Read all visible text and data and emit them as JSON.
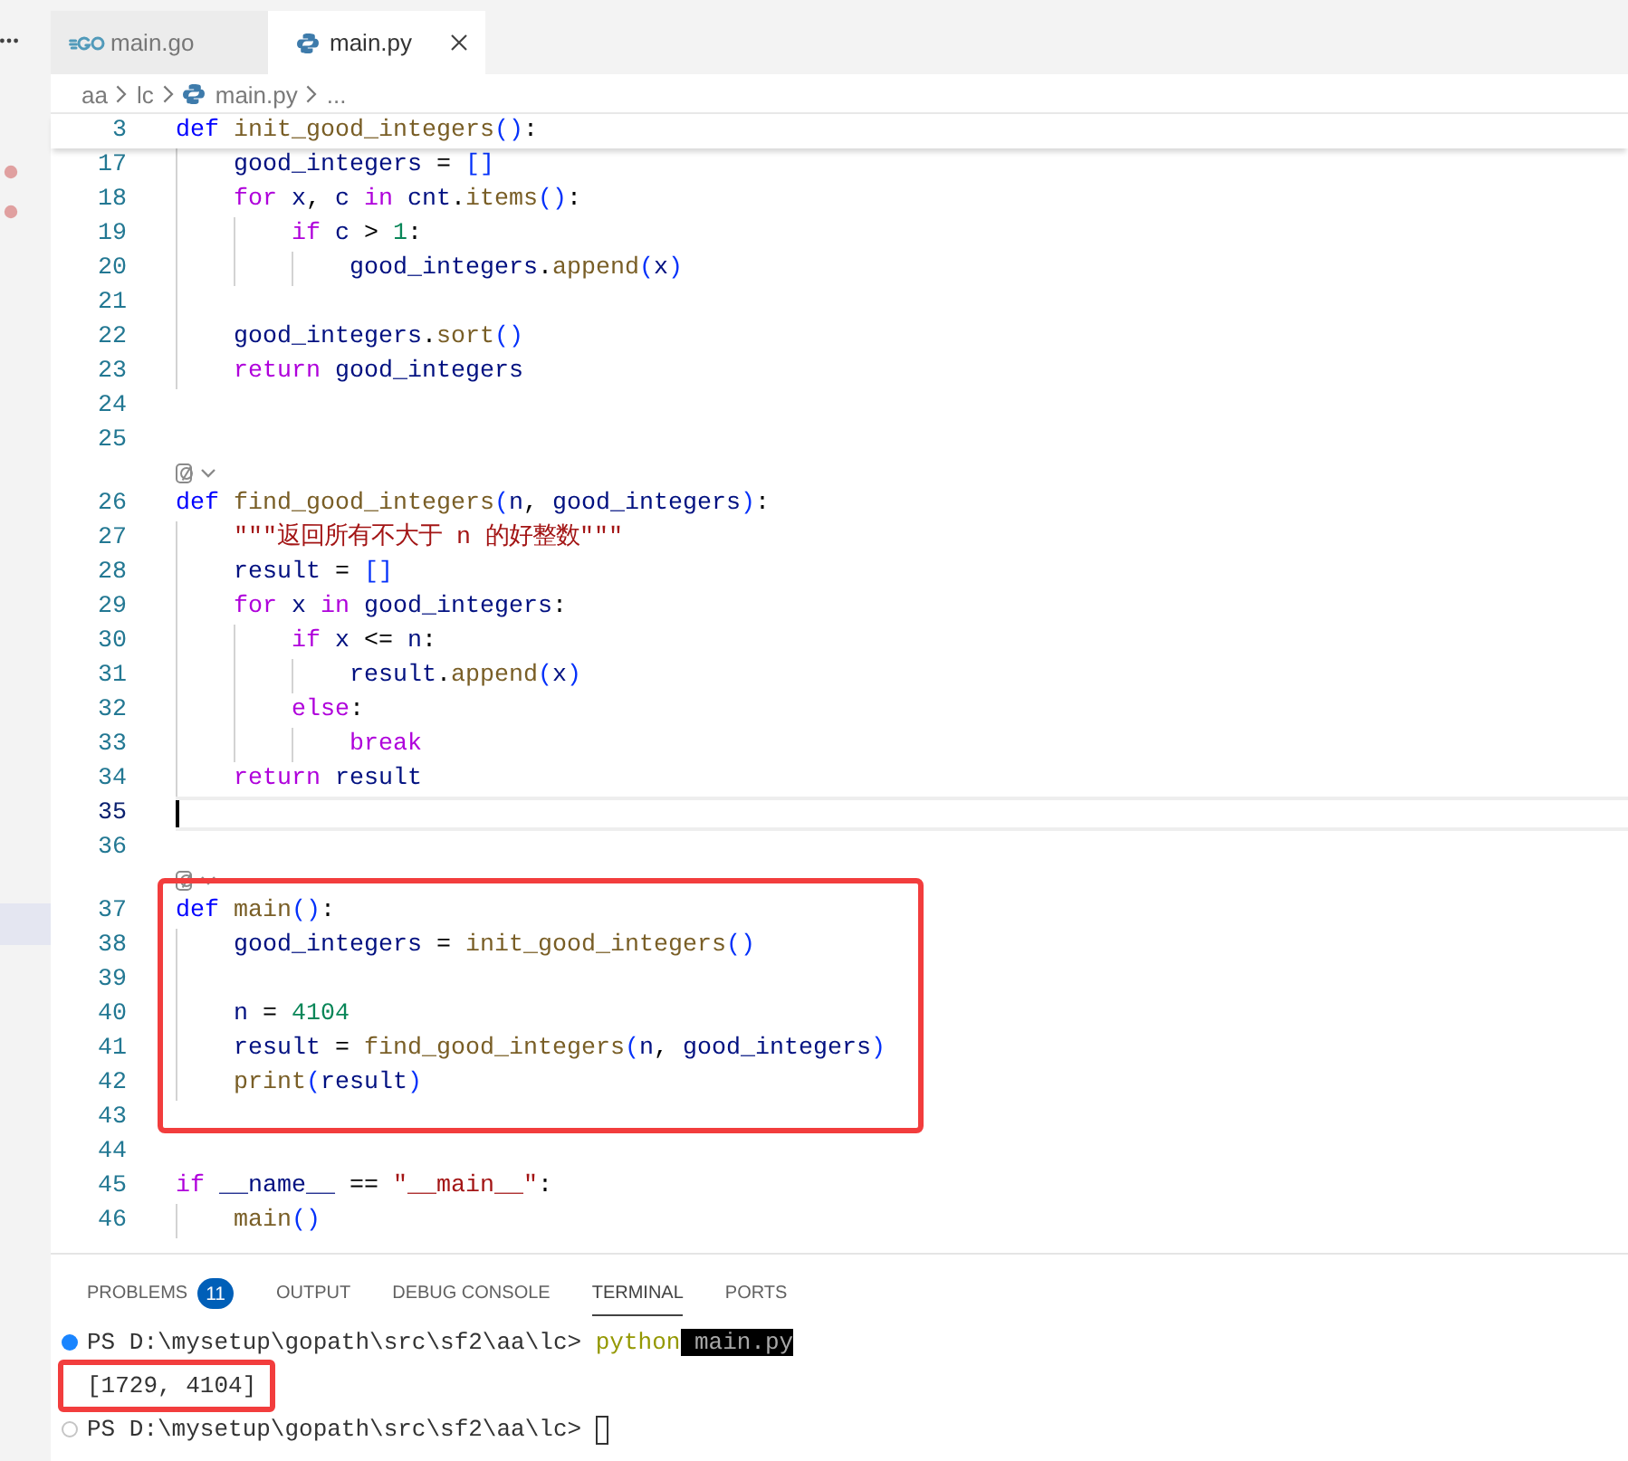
{
  "sidebar": {
    "items": [
      {
        "kind": "marked"
      },
      {
        "kind": "marked"
      },
      {
        "kind": "selected"
      }
    ]
  },
  "tabs": [
    {
      "label": "main.go",
      "kind": "go",
      "selected": false
    },
    {
      "label": "main.py",
      "kind": "python",
      "selected": true
    }
  ],
  "editor": {
    "breadcrumbs": [
      {
        "text": "aa",
        "kind": "folder"
      },
      {
        "text": "lc",
        "kind": "folder"
      },
      {
        "text": "main.py",
        "kind": "file"
      },
      {
        "text": "...",
        "kind": "symbol"
      }
    ],
    "sticky_line": {
      "number": "3",
      "tokens": [
        {
          "text": "def ",
          "kind": "keyword"
        },
        {
          "text": "init_good_integers",
          "kind": "function"
        },
        {
          "text": "()",
          "kind": "bracket"
        },
        {
          "text": ":",
          "kind": "plain"
        }
      ]
    },
    "lines": [
      {
        "kind": "code",
        "number": "17",
        "current": false,
        "tokens": [
          {
            "text": "    good_integers",
            "kind": "variable"
          },
          {
            "text": " = ",
            "kind": "plain"
          },
          {
            "text": "[]",
            "kind": "bracket"
          }
        ]
      },
      {
        "kind": "code",
        "number": "18",
        "current": false,
        "tokens": [
          {
            "text": "    for ",
            "kind": "control"
          },
          {
            "text": "x",
            "kind": "variable"
          },
          {
            "text": ", ",
            "kind": "plain"
          },
          {
            "text": "c",
            "kind": "variable"
          },
          {
            "text": " in ",
            "kind": "control"
          },
          {
            "text": "cnt",
            "kind": "variable"
          },
          {
            "text": ".",
            "kind": "plain"
          },
          {
            "text": "items",
            "kind": "function"
          },
          {
            "text": "()",
            "kind": "bracket"
          },
          {
            "text": ":",
            "kind": "plain"
          }
        ]
      },
      {
        "kind": "code",
        "number": "19",
        "current": false,
        "tokens": [
          {
            "text": "        if ",
            "kind": "control"
          },
          {
            "text": "c",
            "kind": "variable"
          },
          {
            "text": " > ",
            "kind": "plain"
          },
          {
            "text": "1",
            "kind": "number"
          },
          {
            "text": ":",
            "kind": "plain"
          }
        ]
      },
      {
        "kind": "code",
        "number": "20",
        "current": false,
        "tokens": [
          {
            "text": "            good_integers",
            "kind": "variable"
          },
          {
            "text": ".",
            "kind": "plain"
          },
          {
            "text": "append",
            "kind": "function"
          },
          {
            "text": "(",
            "kind": "bracket"
          },
          {
            "text": "x",
            "kind": "variable"
          },
          {
            "text": ")",
            "kind": "bracket"
          }
        ]
      },
      {
        "kind": "code",
        "number": "21",
        "current": false
      },
      {
        "kind": "code",
        "number": "22",
        "current": false,
        "tokens": [
          {
            "text": "    good_integers",
            "kind": "variable"
          },
          {
            "text": ".",
            "kind": "plain"
          },
          {
            "text": "sort",
            "kind": "function"
          },
          {
            "text": "()",
            "kind": "bracket"
          }
        ]
      },
      {
        "kind": "code",
        "number": "23",
        "current": false,
        "tokens": [
          {
            "text": "    return ",
            "kind": "control"
          },
          {
            "text": "good_integers",
            "kind": "variable"
          }
        ]
      },
      {
        "kind": "code",
        "number": "24",
        "current": false
      },
      {
        "kind": "code",
        "number": "25",
        "current": false
      },
      {
        "kind": "codelens"
      },
      {
        "kind": "code",
        "number": "26",
        "current": false,
        "tokens": [
          {
            "text": "def ",
            "kind": "keyword"
          },
          {
            "text": "find_good_integers",
            "kind": "function"
          },
          {
            "text": "(",
            "kind": "bracket"
          },
          {
            "text": "n",
            "kind": "variable"
          },
          {
            "text": ", ",
            "kind": "plain"
          },
          {
            "text": "good_integers",
            "kind": "variable"
          },
          {
            "text": ")",
            "kind": "bracket"
          },
          {
            "text": ":",
            "kind": "plain"
          }
        ]
      },
      {
        "kind": "code",
        "number": "27",
        "current": false,
        "tokens": [
          {
            "text": "    \"\"\"返回所有不大于 n 的好整数\"\"\"",
            "kind": "string"
          }
        ]
      },
      {
        "kind": "code",
        "number": "28",
        "current": false,
        "tokens": [
          {
            "text": "    result",
            "kind": "variable"
          },
          {
            "text": " = ",
            "kind": "plain"
          },
          {
            "text": "[]",
            "kind": "bracket"
          }
        ]
      },
      {
        "kind": "code",
        "number": "29",
        "current": false,
        "tokens": [
          {
            "text": "    for ",
            "kind": "control"
          },
          {
            "text": "x",
            "kind": "variable"
          },
          {
            "text": " in ",
            "kind": "control"
          },
          {
            "text": "good_integers",
            "kind": "variable"
          },
          {
            "text": ":",
            "kind": "plain"
          }
        ]
      },
      {
        "kind": "code",
        "number": "30",
        "current": false,
        "tokens": [
          {
            "text": "        if ",
            "kind": "control"
          },
          {
            "text": "x",
            "kind": "variable"
          },
          {
            "text": " <= ",
            "kind": "plain"
          },
          {
            "text": "n",
            "kind": "variable"
          },
          {
            "text": ":",
            "kind": "plain"
          }
        ]
      },
      {
        "kind": "code",
        "number": "31",
        "current": false,
        "tokens": [
          {
            "text": "            result",
            "kind": "variable"
          },
          {
            "text": ".",
            "kind": "plain"
          },
          {
            "text": "append",
            "kind": "function"
          },
          {
            "text": "(",
            "kind": "bracket"
          },
          {
            "text": "x",
            "kind": "variable"
          },
          {
            "text": ")",
            "kind": "bracket"
          }
        ]
      },
      {
        "kind": "code",
        "number": "32",
        "current": false,
        "tokens": [
          {
            "text": "        else",
            "kind": "control"
          },
          {
            "text": ":",
            "kind": "plain"
          }
        ]
      },
      {
        "kind": "code",
        "number": "33",
        "current": false,
        "tokens": [
          {
            "text": "            break",
            "kind": "control"
          }
        ]
      },
      {
        "kind": "code",
        "number": "34",
        "current": false,
        "tokens": [
          {
            "text": "    return ",
            "kind": "control"
          },
          {
            "text": "result",
            "kind": "variable"
          }
        ]
      },
      {
        "kind": "code",
        "number": "35",
        "current": true
      },
      {
        "kind": "code",
        "number": "36",
        "current": false
      },
      {
        "kind": "codelens"
      },
      {
        "kind": "highlight",
        "lines": [
          {
            "kind": "code",
            "number": "37",
            "current": false,
            "tokens": [
              {
                "text": "def ",
                "kind": "keyword"
              },
              {
                "text": "main",
                "kind": "function"
              },
              {
                "text": "()",
                "kind": "bracket"
              },
              {
                "text": ":",
                "kind": "plain"
              }
            ]
          },
          {
            "kind": "code",
            "number": "38",
            "current": false,
            "tokens": [
              {
                "text": "    good_integers",
                "kind": "variable"
              },
              {
                "text": " = ",
                "kind": "plain"
              },
              {
                "text": "init_good_integers",
                "kind": "function"
              },
              {
                "text": "()",
                "kind": "bracket"
              }
            ]
          },
          {
            "kind": "code",
            "number": "39",
            "current": false
          },
          {
            "kind": "code",
            "number": "40",
            "current": false,
            "tokens": [
              {
                "text": "    n",
                "kind": "variable"
              },
              {
                "text": " = ",
                "kind": "plain"
              },
              {
                "text": "4104",
                "kind": "number"
              }
            ]
          },
          {
            "kind": "code",
            "number": "41",
            "current": false,
            "tokens": [
              {
                "text": "    result",
                "kind": "variable"
              },
              {
                "text": " = ",
                "kind": "plain"
              },
              {
                "text": "find_good_integers",
                "kind": "function"
              },
              {
                "text": "(",
                "kind": "bracket"
              },
              {
                "text": "n",
                "kind": "variable"
              },
              {
                "text": ", ",
                "kind": "plain"
              },
              {
                "text": "good_integers",
                "kind": "variable"
              },
              {
                "text": ")",
                "kind": "bracket"
              }
            ]
          },
          {
            "kind": "code",
            "number": "42",
            "current": false,
            "tokens": [
              {
                "text": "    print",
                "kind": "function"
              },
              {
                "text": "(",
                "kind": "bracket"
              },
              {
                "text": "result",
                "kind": "variable"
              },
              {
                "text": ")",
                "kind": "bracket"
              }
            ]
          },
          {
            "kind": "code",
            "number": "43",
            "current": false
          }
        ]
      },
      {
        "kind": "code",
        "number": "44",
        "current": false
      },
      {
        "kind": "code",
        "number": "45",
        "current": false,
        "tokens": [
          {
            "text": "if ",
            "kind": "control"
          },
          {
            "text": "__name__",
            "kind": "variable"
          },
          {
            "text": " == ",
            "kind": "plain"
          },
          {
            "text": "\"__main__\"",
            "kind": "string"
          },
          {
            "text": ":",
            "kind": "plain"
          }
        ]
      },
      {
        "kind": "code",
        "number": "46",
        "current": false,
        "tokens": [
          {
            "text": "    main",
            "kind": "function"
          },
          {
            "text": "()",
            "kind": "bracket"
          }
        ]
      }
    ]
  },
  "panel": {
    "tabs": [
      {
        "label": "PROBLEMS",
        "badge": "11",
        "selected": false
      },
      {
        "label": "OUTPUT",
        "selected": false
      },
      {
        "label": "DEBUG CONSOLE",
        "selected": false
      },
      {
        "label": "TERMINAL",
        "selected": true
      },
      {
        "label": "PORTS",
        "selected": false
      }
    ],
    "terminal": {
      "lines": [
        {
          "kind": "command",
          "cursor": false,
          "tokens": [
            {
              "text": "PS D:\\mysetup\\gopath\\src\\sf2\\aa\\lc> ",
              "kind": "plain"
            },
            {
              "text": "python",
              "kind": "command"
            },
            {
              "text": " main.py",
              "kind": "inverse"
            }
          ]
        },
        {
          "kind": "highlight",
          "lines": [
            {
              "kind": "output",
              "cursor": false,
              "tokens": [
                {
                  "text": "[1729, 4104]",
                  "kind": "plain"
                }
              ]
            }
          ]
        },
        {
          "kind": "prompt",
          "cursor": true,
          "tokens": [
            {
              "text": "PS D:\\mysetup\\gopath\\src\\sf2\\aa\\lc> ",
              "kind": "plain"
            }
          ]
        }
      ]
    }
  }
}
